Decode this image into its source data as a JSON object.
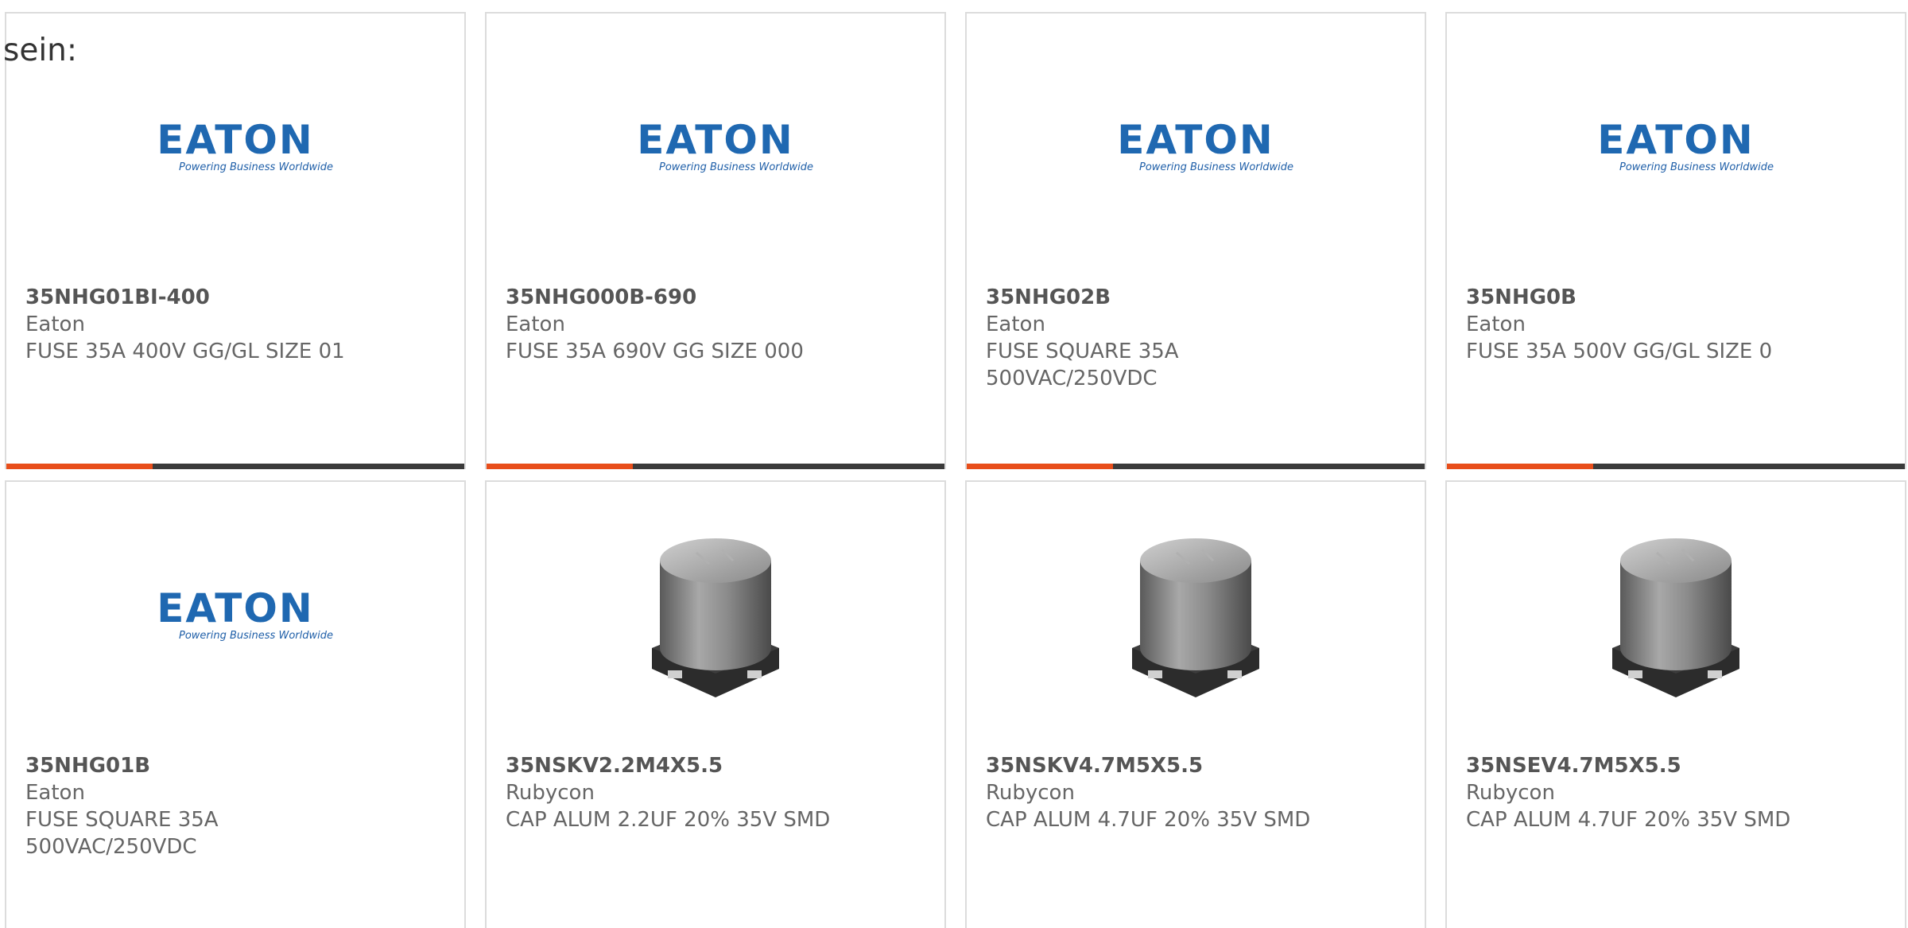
{
  "intro_text": "sein:",
  "logo": {
    "brand": "EATON",
    "tagline": "Powering Business Worldwide"
  },
  "colors": {
    "accent": "#e84e1b",
    "bar": "#3b3b3b",
    "eaton_blue": "#1f68b1"
  },
  "products": [
    {
      "part_number": "35NHG01BI-400",
      "manufacturer": "Eaton",
      "description": "FUSE 35A 400V GG/GL SIZE 01",
      "image": "eaton-logo"
    },
    {
      "part_number": "35NHG000B-690",
      "manufacturer": "Eaton",
      "description": "FUSE 35A 690V GG SIZE 000",
      "image": "eaton-logo"
    },
    {
      "part_number": "35NHG02B",
      "manufacturer": "Eaton",
      "description": "FUSE SQUARE 35A 500VAC/250VDC",
      "image": "eaton-logo"
    },
    {
      "part_number": "35NHG0B",
      "manufacturer": "Eaton",
      "description": "FUSE 35A 500V GG/GL SIZE 0",
      "image": "eaton-logo"
    },
    {
      "part_number": "35NHG01B",
      "manufacturer": "Eaton",
      "description": "FUSE SQUARE 35A 500VAC/250VDC",
      "image": "eaton-logo"
    },
    {
      "part_number": "35NSKV2.2M4X5.5",
      "manufacturer": "Rubycon",
      "description": "CAP ALUM 2.2UF 20% 35V SMD",
      "image": "capacitor-photo"
    },
    {
      "part_number": "35NSKV4.7M5X5.5",
      "manufacturer": "Rubycon",
      "description": "CAP ALUM 4.7UF 20% 35V SMD",
      "image": "capacitor-photo"
    },
    {
      "part_number": "35NSEV4.7M5X5.5",
      "manufacturer": "Rubycon",
      "description": "CAP ALUM 4.7UF 20% 35V SMD",
      "image": "capacitor-photo"
    }
  ]
}
